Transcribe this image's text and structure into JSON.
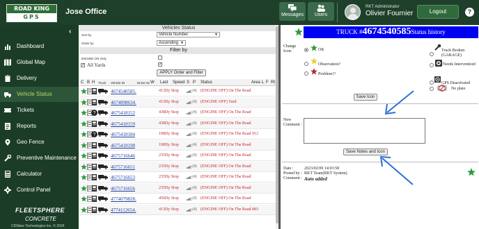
{
  "header": {
    "logo_top": "ROAD KING",
    "logo_bottom": "GPS",
    "office": "Jose Office",
    "messages_label": "Messages",
    "users_label": "Users",
    "role": "RKT Administrator",
    "user_name": "Olivier Fournier",
    "logout_label": "Logout",
    "help_label": "?"
  },
  "sidebar": {
    "collapse": "‹",
    "items": [
      {
        "label": "Dashboard",
        "icon": "bar-chart-icon"
      },
      {
        "label": "Global Map",
        "icon": "map-icon"
      },
      {
        "label": "Delivery",
        "icon": "clipboard-icon"
      },
      {
        "label": "Vehicle Status",
        "icon": "truck-icon",
        "active": true
      },
      {
        "label": "Tickets",
        "icon": "ticket-icon"
      },
      {
        "label": "Reports",
        "icon": "report-icon"
      },
      {
        "label": "Geo Fence",
        "icon": "geo-fence-icon"
      },
      {
        "label": "Preventive Maintenance",
        "icon": "wrench-icon"
      },
      {
        "label": "Calculator",
        "icon": "calculator-icon"
      },
      {
        "label": "Control Panel",
        "icon": "gear-icon"
      }
    ],
    "brand_line1": "FLEETSPHERE",
    "brand_line2": "CONCRETE",
    "copyright": "CDWare Technologies Inc. © 2024"
  },
  "vehicle_status": {
    "title": "Vehicles Status",
    "sort_by_label": "Sort by",
    "sort_by_value": "Vehicle Number",
    "order_by_label": "Order by",
    "order_by_value": "Ascending",
    "filter_title": "Filter by",
    "engine_on_label": "ENGINE ON Only",
    "all_yards_label": "All Yards",
    "apply_label": "APPLY Order and Filter",
    "columns": [
      "C",
      "B",
      "H",
      "Truck",
      "Vehicle ID",
      "Driver ID",
      "W",
      "Last",
      "Speed",
      "S",
      "P",
      "Status",
      "Area",
      "L",
      "F",
      "Rt"
    ],
    "rows": [
      {
        "icon": "computer",
        "id": "4674540585",
        "suffix": ".",
        "time": "413",
        "last": "Dy Stop",
        "sat": "(4)",
        "status": "(ENGINE OFF) On The Road"
      },
      {
        "icon": "computer",
        "id": "4674898634",
        "suffix": ".",
        "time": "413",
        "last": "Dy Stop",
        "sat": "(4)",
        "status": "(ENGINE OFF) Yard"
      },
      {
        "icon": "question",
        "id": "4675418152",
        "suffix": "",
        "time": "438",
        "last": "Dy Stop",
        "sat": "(4)",
        "status": "(ENGINE OFF) On The Road"
      },
      {
        "icon": "computer",
        "id": "4675418159",
        "suffix": "",
        "time": "438",
        "last": "Dy Stop",
        "sat": "(4)",
        "status": "(ENGINE OFF) On The Road"
      },
      {
        "icon": "question",
        "id": "4675418184",
        "suffix": "",
        "time": "108",
        "last": "Dy Stop",
        "sat": "(4)",
        "status": "(ENGINE OFF) On The Road 912"
      },
      {
        "icon": "computer",
        "id": "4675418198",
        "suffix": "",
        "time": "108",
        "last": "Dy Stop",
        "sat": "(4)",
        "status": "(ENGINE OFF) On The Road"
      },
      {
        "icon": "computer",
        "id": "4675716646",
        "suffix": "",
        "time": "235",
        "last": "Dy Stop",
        "sat": "(4)",
        "status": "(ENGINE OFF) On The Road"
      },
      {
        "icon": "computer",
        "id": "4675716651",
        "suffix": "",
        "time": "235",
        "last": "Dy Stop",
        "sat": "(4)",
        "status": "(ENGINE OFF) On The Road"
      },
      {
        "icon": "computer",
        "id": "4675716653",
        "suffix": "",
        "time": "235",
        "last": "Dy Stop",
        "sat": "(4)",
        "status": "(ENGINE OFF) On The Road"
      },
      {
        "icon": "computer",
        "id": "4675716656",
        "suffix": "",
        "time": "235",
        "last": "Dy Stop",
        "sat": "(4)",
        "status": "(ENGINE OFF) On The Road"
      },
      {
        "icon": "computer",
        "id": "4774079828",
        "suffix": ".",
        "time": "456",
        "last": "Dy Stop",
        "sat": "(4)",
        "status": "(ENGINE OFF) On The Road"
      },
      {
        "icon": "computer",
        "id": "4774112654",
        "suffix": ".",
        "time": "413",
        "last": "Dy Stop",
        "sat": "(4)",
        "status": "(ENGINE OFF) On The Road 883"
      }
    ]
  },
  "truck_panel": {
    "title_prefix": "TRUCK #",
    "truck_number": "4674540585",
    "title_suffix": "Status history",
    "change_icon_label1": "Change",
    "change_icon_label2": "Icon:",
    "opt_ok": "OK",
    "opt_observation": "Observation?",
    "opt_problem": "Problem!?",
    "opt_broken": "Truck Broken (GARAGE)",
    "opt_intervention": "Needs Intervention!",
    "opt_gps": "GPS Deactivated",
    "opt_no_plate": "No plate",
    "save_icon_label": "Save Icon",
    "new_comment_label1": "New",
    "new_comment_label2": "Comment :",
    "save_notes_label": "Save Notes and Icon",
    "date_label": "Date :",
    "date_value": "2023/02/09 14:03:58",
    "posted_label": "Posted by :",
    "posted_value": "RKT Team(RKT System)",
    "comment_label": "Comment :",
    "comment_value": "Auto added"
  },
  "colors": {
    "topbar": "#1e3f2a",
    "sidebar": "#1b3d27",
    "truck_header": "#0000f2",
    "status_red": "#c0262d",
    "arrow_blue": "#2a6fd6",
    "star_green": "#2e9a3a"
  }
}
